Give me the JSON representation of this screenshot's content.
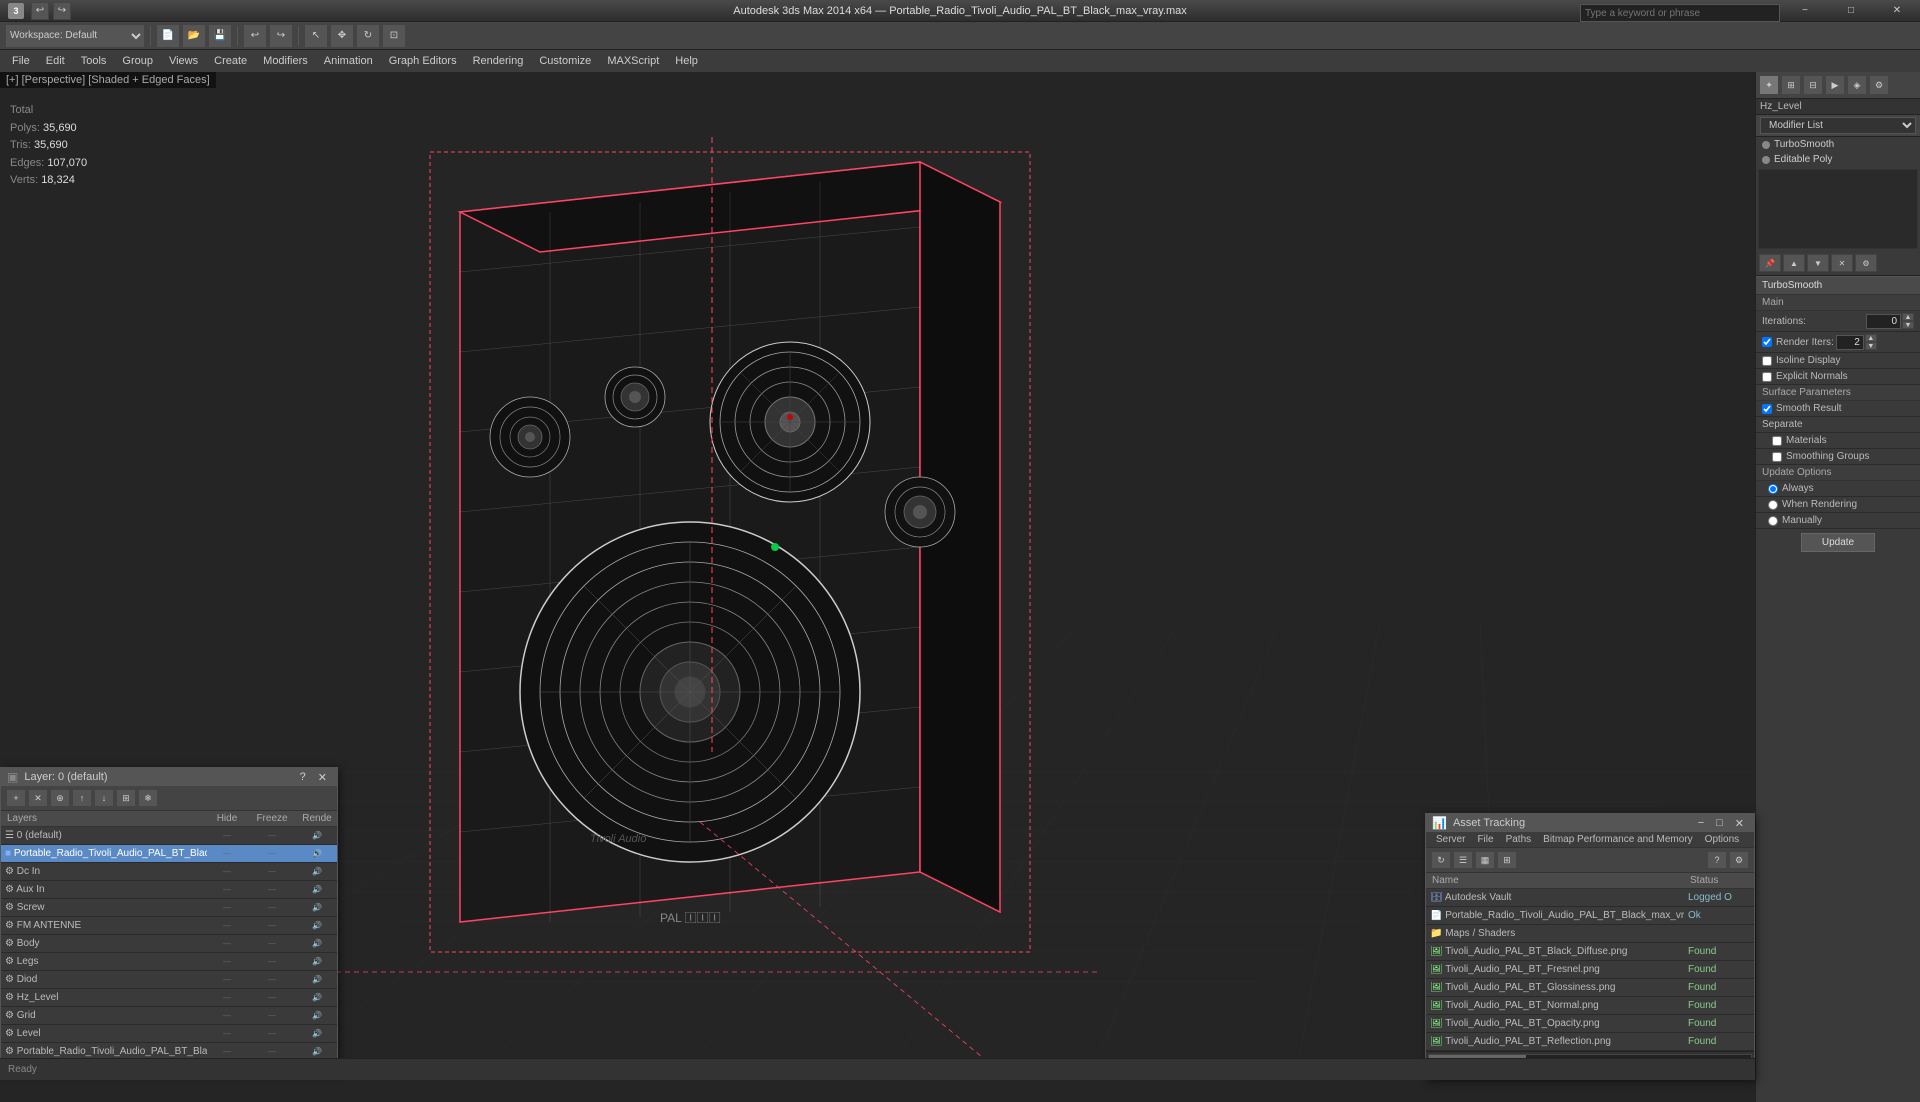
{
  "titlebar": {
    "app_title": "Autodesk 3ds Max 2014 x64",
    "file_title": "Portable_Radio_Tivoli_Audio_PAL_BT_Black_max_vray.max",
    "minimize": "−",
    "maximize": "□",
    "close": "✕"
  },
  "toolbar": {
    "workspace_label": "Workspace: Default",
    "search_placeholder": "Type a keyword or phrase"
  },
  "menu": {
    "items": [
      "File",
      "Edit",
      "Tools",
      "Group",
      "Views",
      "Create",
      "Modifiers",
      "Animation",
      "Graph Editors",
      "Rendering",
      "Customize",
      "MAXScript",
      "Help"
    ]
  },
  "viewport": {
    "label": "[+] [Perspective] [Shaded + Edged Faces]"
  },
  "stats": {
    "polys_label": "Polys:",
    "polys_value": "35,690",
    "tris_label": "Tris:",
    "tris_value": "35,690",
    "edges_label": "Edges:",
    "edges_value": "107,070",
    "verts_label": "Verts:",
    "verts_value": "18,324",
    "total_label": "Total"
  },
  "right_panel": {
    "modifier_label": "Hz_Level",
    "modifier_list_label": "Modifier List",
    "turbosmooth": "TurboSmooth",
    "editable_poly": "Editable Poly",
    "section_turbosmooth": "TurboSmooth",
    "section_main": "Main",
    "iterations_label": "Iterations:",
    "iterations_value": "0",
    "render_iters_label": "Render Iters:",
    "render_iters_value": "2",
    "isoline_display": "Isoline Display",
    "explicit_normals": "Explicit Normals",
    "section_surface": "Surface Parameters",
    "smooth_result": "Smooth Result",
    "separate_label": "Separate",
    "materials": "Materials",
    "smoothing_groups": "Smoothing Groups",
    "update_options": "Update Options",
    "always": "Always",
    "when_rendering": "When Rendering",
    "manually": "Manually",
    "update_btn": "Update"
  },
  "layers": {
    "title": "Layer: 0 (default)",
    "help_btn": "?",
    "columns": {
      "name": "Layers",
      "hide": "Hide",
      "freeze": "Freeze",
      "render": "Rende"
    },
    "rows": [
      {
        "name": "0 (default)",
        "indent": 0,
        "type": "layer",
        "active": false
      },
      {
        "name": "Portable_Radio_Tivoli_Audio_PAL_BT_Black",
        "indent": 1,
        "type": "object",
        "active": true
      },
      {
        "name": "Dc In",
        "indent": 2,
        "type": "sub"
      },
      {
        "name": "Aux In",
        "indent": 2,
        "type": "sub"
      },
      {
        "name": "Screw",
        "indent": 2,
        "type": "sub"
      },
      {
        "name": "FM ANTENNE",
        "indent": 2,
        "type": "sub"
      },
      {
        "name": "Body",
        "indent": 2,
        "type": "sub"
      },
      {
        "name": "Legs",
        "indent": 2,
        "type": "sub"
      },
      {
        "name": "Diod",
        "indent": 2,
        "type": "sub"
      },
      {
        "name": "Hz_Level",
        "indent": 2,
        "type": "sub"
      },
      {
        "name": "Grid",
        "indent": 2,
        "type": "sub"
      },
      {
        "name": "Level",
        "indent": 2,
        "type": "sub"
      },
      {
        "name": "Portable_Radio_Tivoli_Audio_PAL_BT_Black",
        "indent": 2,
        "type": "sub"
      }
    ]
  },
  "asset_tracking": {
    "title": "Asset Tracking",
    "menu_items": [
      "Server",
      "File",
      "Paths",
      "Bitmap Performance and Memory",
      "Options"
    ],
    "columns": {
      "name": "Name",
      "status": "Status"
    },
    "rows": [
      {
        "name": "Autodesk Vault",
        "indent": 0,
        "status": "Logged O",
        "type": "vault"
      },
      {
        "name": "Portable_Radio_Tivoli_Audio_PAL_BT_Black_max_vray.m...",
        "indent": 1,
        "status": "Ok",
        "type": "file"
      },
      {
        "name": "Maps / Shaders",
        "indent": 2,
        "status": "",
        "type": "folder"
      },
      {
        "name": "Tivoli_Audio_PAL_BT_Black_Diffuse.png",
        "indent": 3,
        "status": "Found",
        "type": "map"
      },
      {
        "name": "Tivoli_Audio_PAL_BT_Fresnel.png",
        "indent": 3,
        "status": "Found",
        "type": "map"
      },
      {
        "name": "Tivoli_Audio_PAL_BT_Glossiness.png",
        "indent": 3,
        "status": "Found",
        "type": "map"
      },
      {
        "name": "Tivoli_Audio_PAL_BT_Normal.png",
        "indent": 3,
        "status": "Found",
        "type": "map"
      },
      {
        "name": "Tivoli_Audio_PAL_BT_Opacity.png",
        "indent": 3,
        "status": "Found",
        "type": "map"
      },
      {
        "name": "Tivoli_Audio_PAL_BT_Reflection.png",
        "indent": 3,
        "status": "Found",
        "type": "map"
      }
    ]
  }
}
